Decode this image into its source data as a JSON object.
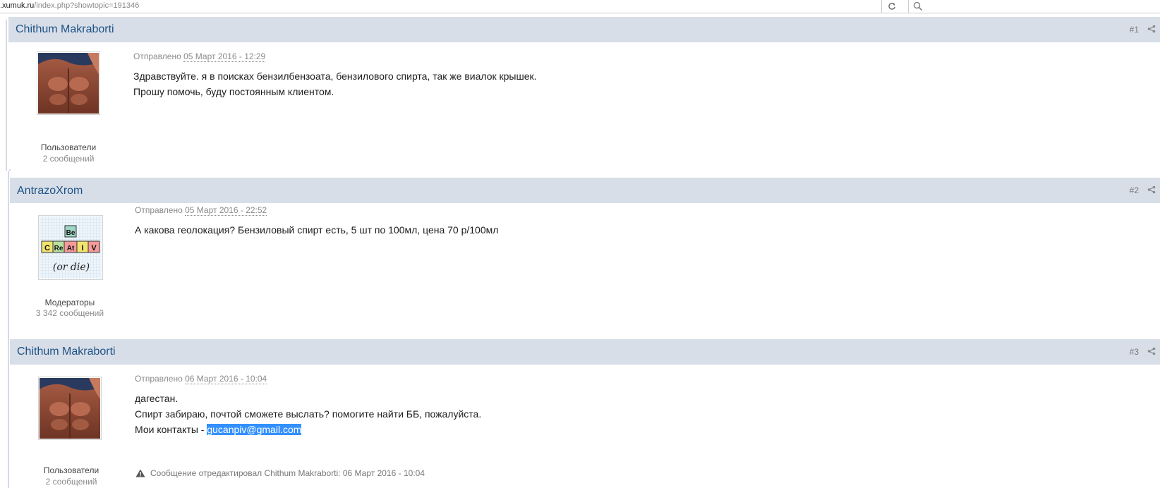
{
  "browser": {
    "url_host": ".xumuk.ru",
    "url_path": "/index.php?showtopic=191346",
    "reload_icon": "reload-icon",
    "search_icon": "search-icon"
  },
  "posts": [
    {
      "author": "Chithum Makraborti",
      "number": "#1",
      "group": "Пользователи",
      "message_count": "2 сообщений",
      "posted_label": "Отправлено",
      "posted_date": "05 Март 2016 - 12:29",
      "lines": [
        "Здравствуйте. я в поисках бензилбензоата, бензилового спирта, так же виалок  крышек.",
        "Прошу помочь, буду постоянным клиентом."
      ]
    },
    {
      "author": "AntrazoXrom",
      "number": "#2",
      "group": "Модераторы",
      "message_count": "3 342 сообщений",
      "posted_label": "Отправлено",
      "posted_date": "05 Март 2016 - 22:52",
      "lines": [
        "А какова геолокация? Бензиловый спирт есть, 5 шт по 100мл, цена 70 р/100мл"
      ],
      "avatar_text": {
        "top": "Be",
        "row": [
          "C",
          "Re",
          "At",
          "I",
          "V"
        ],
        "bottom": "(or die)"
      }
    },
    {
      "author": "Chithum Makraborti",
      "number": "#3",
      "group": "Пользователи",
      "message_count": "2 сообщений",
      "posted_label": "Отправлено",
      "posted_date": "06 Март 2016 - 10:04",
      "lines": [
        "дагестан.",
        "Спирт забираю, почтой сможете выслать? помогите найти ББ, пожалуйста.",
        "Мои контакты - "
      ],
      "email": "gucanpiv@gmail.com",
      "edit_note": "Сообщение отредактировал Chithum Makraborti: 06 Март 2016 - 10:04"
    }
  ],
  "colors": {
    "header_bg": "#d8dee8",
    "author_link": "#1d5285",
    "selection": "#3390ff"
  }
}
